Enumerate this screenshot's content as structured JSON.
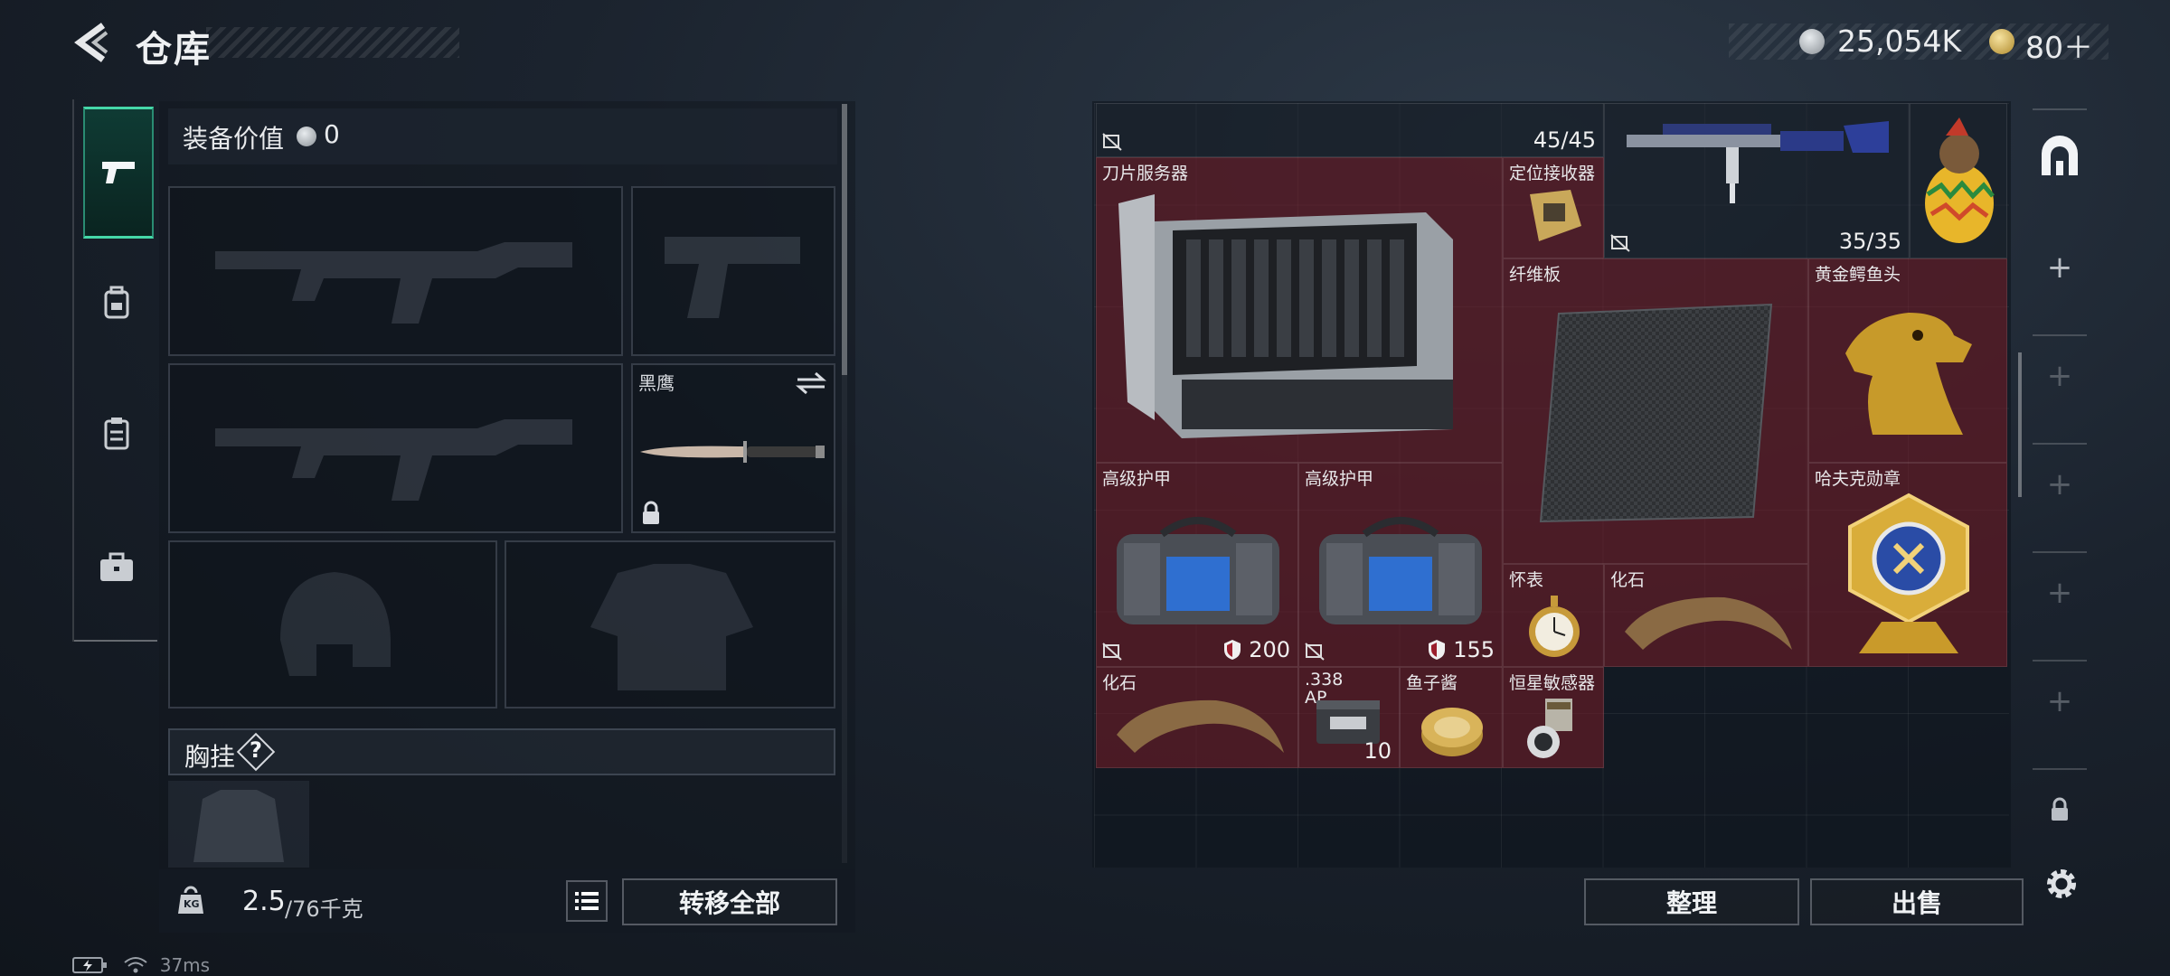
{
  "header": {
    "title": "仓库",
    "currency_silver": "25,054K",
    "currency_gold": "80＋"
  },
  "tabs": [
    "pistol-icon",
    "backpack-icon",
    "clipboard-icon",
    "briefcase-icon"
  ],
  "equipment": {
    "value_label": "装备价值",
    "value": "0",
    "melee_name": "黑鹰",
    "chest_rig_label": "胸挂",
    "chest_rig_help": "?"
  },
  "bottom_left": {
    "weight_current": "2.5",
    "weight_max": "/76千克",
    "transfer_all": "转移全部",
    "weight_icon_text": "KG"
  },
  "grid": {
    "top_stack": "45/45",
    "blade_server": "刀片服务器",
    "positioning_receiver": "定位接收器",
    "rifle_ammo": "35/35",
    "fiberboard": "纤维板",
    "golden_crocodile": "黄金鳄鱼头",
    "armor_1": "高级护甲",
    "armor_1_val": "200",
    "armor_2": "高级护甲",
    "armor_2_val": "155",
    "havoc_medal": "哈夫克勋章",
    "pocket_watch": "怀表",
    "fossil_1": "化石",
    "fossil_2": "化石",
    "ammo_338_line1": ".338",
    "ammo_338_line2": "AP",
    "ammo_338_count": "10",
    "caviar": "鱼子酱",
    "star_sensor": "恒星敏感器"
  },
  "bottom_right": {
    "sort": "整理",
    "sell": "出售"
  },
  "status": {
    "ping": "37ms"
  },
  "colors": {
    "accent_green": "#45d8a8",
    "item_red": "#7a1e28"
  }
}
